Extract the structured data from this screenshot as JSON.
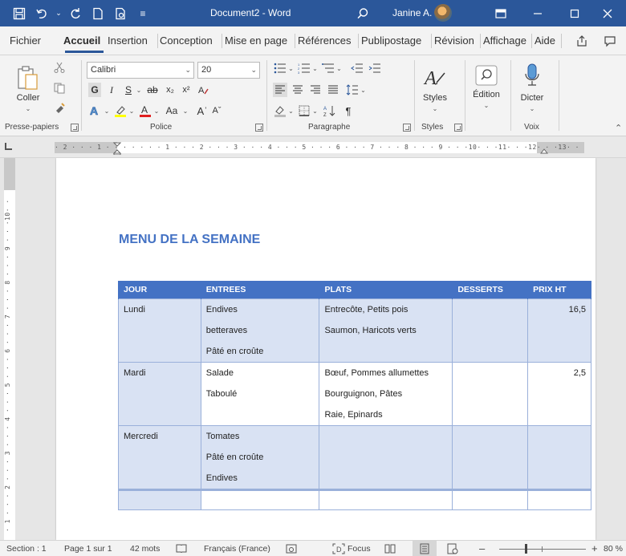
{
  "title_bar": {
    "document_title": "Document2  -  Word",
    "user_name": "Janine A.",
    "colors": {
      "background": "#2b579a"
    }
  },
  "menu_tabs": [
    "Fichier",
    "Accueil",
    "Insertion",
    "Conception",
    "Mise en page",
    "Références",
    "Publipostage",
    "Révision",
    "Affichage",
    "Aide"
  ],
  "active_tab": "Accueil",
  "ribbon": {
    "clipboard": {
      "paste_label": "Coller",
      "group_label": "Presse-papiers"
    },
    "font": {
      "font_name": "Calibri",
      "font_size": "20",
      "aa_label": "Aa",
      "group_label": "Police"
    },
    "paragraph": {
      "group_label": "Paragraphe"
    },
    "styles": {
      "styles_label": "Styles",
      "group_label": "Styles"
    },
    "editing": {
      "label": "Édition"
    },
    "voice": {
      "dictate_label": "Dicter",
      "group_label": "Voix"
    }
  },
  "ruler": {
    "horizontal_text": "· 2 · · · 1 · · · · · · · 1 · · · 2 · · · 3 · · · 4 · · · 5 · · · 6 · · · 7 · · · 8 · · · 9 · · ·10· · ·11· · ·12· · ·13· · ·14· · ·15· · · · · ·17· · ·18·",
    "vertical_text": "· 1 · · · 2 · · · 3 · · · 4 · · · 5 · · · 6 · · · 7 · · · 8 · · · 9 · · ·10· · ·11· · ·12· · ·13·"
  },
  "document": {
    "heading": "MENU DE LA SEMAINE",
    "table": {
      "headers": [
        "JOUR",
        "ENTREES",
        "PLATS",
        "DESSERTS",
        "PRIX HT"
      ],
      "rows": [
        {
          "jour": "Lundi",
          "entrees": [
            "Endives",
            "betteraves",
            "Pâté en croûte"
          ],
          "plats": [
            "Entrecôte, Petits pois",
            "Saumon, Haricots verts"
          ],
          "desserts": "",
          "prix": "16,5"
        },
        {
          "jour": "Mardi",
          "entrees": [
            "Salade",
            "Taboulé"
          ],
          "plats": [
            "Bœuf, Pommes allumettes",
            "Bourguignon, Pâtes",
            "Raie, Epinards"
          ],
          "desserts": "",
          "prix": "2,5"
        },
        {
          "jour": "Mercredi",
          "entrees": [
            "Tomates",
            "Pâté en croûte",
            "Endives"
          ],
          "plats": [],
          "desserts": "",
          "prix": ""
        }
      ],
      "colors": {
        "header": "#4472c4",
        "band": "#d9e2f3"
      }
    }
  },
  "status_bar": {
    "section": "Section : 1",
    "page": "Page 1 sur 1",
    "words": "42 mots",
    "language": "Français (France)",
    "focus": "Focus",
    "zoom": "80 %"
  }
}
